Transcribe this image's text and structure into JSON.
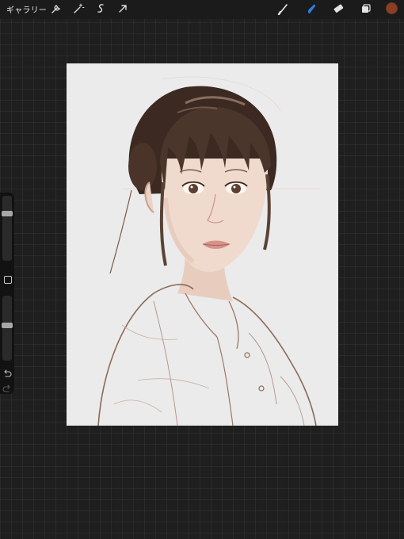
{
  "toolbar": {
    "gallery_label": "ギャラリー",
    "left_tools": [
      "wrench-icon",
      "magic-wand-icon",
      "selection-icon",
      "transform-arrow-icon"
    ],
    "right_tools": [
      "brush-icon",
      "smudge-icon",
      "eraser-icon",
      "layers-icon"
    ],
    "active_tool": "smudge-icon",
    "active_tool_color": "#2f7de1",
    "current_color": "#8c3d24"
  },
  "sidebar": {
    "brush_size_level": 0.25,
    "opacity_level": 0.45,
    "icons": [
      "modify-square-icon",
      "undo-icon",
      "redo-icon"
    ]
  },
  "canvas": {
    "background": "#ebebeb",
    "content": "portrait-sketch"
  }
}
